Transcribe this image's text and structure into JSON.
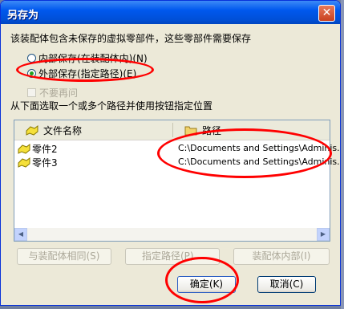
{
  "dialog": {
    "title": "另存为",
    "close_symbol": "✕",
    "message": "该装配体包含未保存的虚拟零部件，这些零部件需要保存",
    "radio_internal": "内部保存(在装配体内)(N)",
    "radio_external": "外部保存(指定路径)(E)",
    "checkbox_label": "不要再问",
    "instruction": "从下面选取一个或多个路径并使用按钮指定位置"
  },
  "list": {
    "col_filename": "文件名称",
    "col_path": "路径",
    "rows": [
      {
        "name": "零件2",
        "path": "C:\\Documents and Settings\\Adminis..."
      },
      {
        "name": "零件3",
        "path": "C:\\Documents and Settings\\Adminis..."
      }
    ]
  },
  "buttons": {
    "same_as_assembly": "与装配体相同(S)",
    "specify_path": "指定路径(P)...",
    "inside_assembly": "装配体内部(I)",
    "ok": "确定(K)",
    "cancel": "取消(C)"
  },
  "colors": {
    "title_bar": "#0058ee",
    "annotation": "#ff0000"
  },
  "icons": [
    "close-icon",
    "part-icon",
    "folder-icon",
    "scroll-left-icon",
    "scroll-right-icon"
  ]
}
